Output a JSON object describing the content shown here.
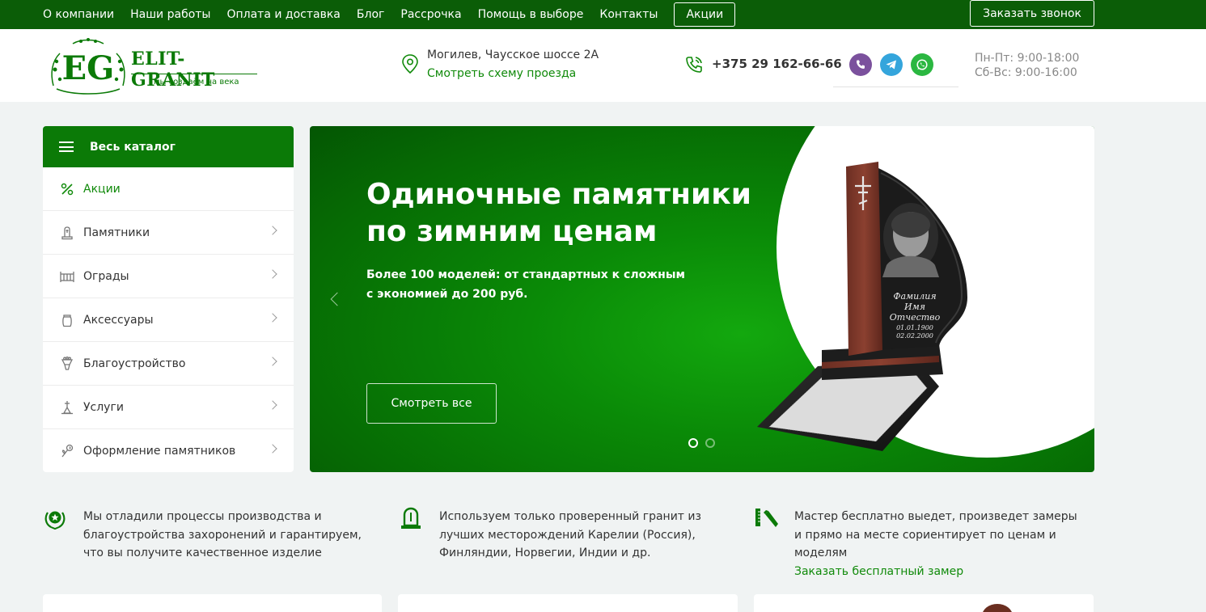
{
  "topbar": {
    "nav": [
      "О компании",
      "Наши работы",
      "Оплата и доставка",
      "Блог",
      "Рассрочка",
      "Помощь в выборе",
      "Контакты"
    ],
    "promo": "Акции",
    "call": "Заказать звонок"
  },
  "header": {
    "logo_mark": "EG",
    "logo_name": "ELIT-GRANIT",
    "logo_tag": "мы создаём на века",
    "address": "Могилев, Чаусское шоссе 2А",
    "address_link": "Смотреть схему проезда",
    "phone": "+375 29 162-66-66",
    "hours_weekday": "Пн-Пт: 9:00-18:00",
    "hours_weekend": "Сб-Вс: 9:00-16:00",
    "messenger_icons": [
      "viber-icon",
      "telegram-icon",
      "whatsapp-icon"
    ]
  },
  "catalog": {
    "title": "Весь каталог",
    "items": [
      {
        "label": "Акции",
        "icon": "percent-icon"
      },
      {
        "label": "Памятники",
        "icon": "monument-icon"
      },
      {
        "label": "Ограды",
        "icon": "fence-icon"
      },
      {
        "label": "Аксессуары",
        "icon": "vase-icon"
      },
      {
        "label": "Благоустройство",
        "icon": "flowers-icon"
      },
      {
        "label": "Услуги",
        "icon": "service-icon"
      },
      {
        "label": "Оформление памятников",
        "icon": "rose-icon"
      }
    ]
  },
  "banner": {
    "title": "Одиночные памятники по зимним ценам",
    "subtitle": "Более 100 моделей: от стандартных к сложным с экономией до 200 руб.",
    "cta": "Смотреть все",
    "plate_lines": [
      "Фамилия",
      "Имя",
      "Отчество",
      "01.01.1900",
      "02.02.2000"
    ]
  },
  "features": [
    {
      "text": "Мы отладили процессы производства и благоустройства захоронений и гарантируем, что вы получите качественное изделие",
      "link": ""
    },
    {
      "text": "Используем только проверенный гранит из лучших месторождений Карелии (Россия), Финляндии, Норвегии, Индии и др.",
      "link": ""
    },
    {
      "text": "Мастер бесплатно выедет, произведет замеры и прямо на месте сориентирует по ценам и моделям",
      "link": "Заказать бесплатный замер"
    }
  ],
  "colors": {
    "brand_dark": "#0b5d07",
    "brand": "#0b7a07",
    "link": "#108a0a",
    "page_bg": "#f0f3f3"
  }
}
